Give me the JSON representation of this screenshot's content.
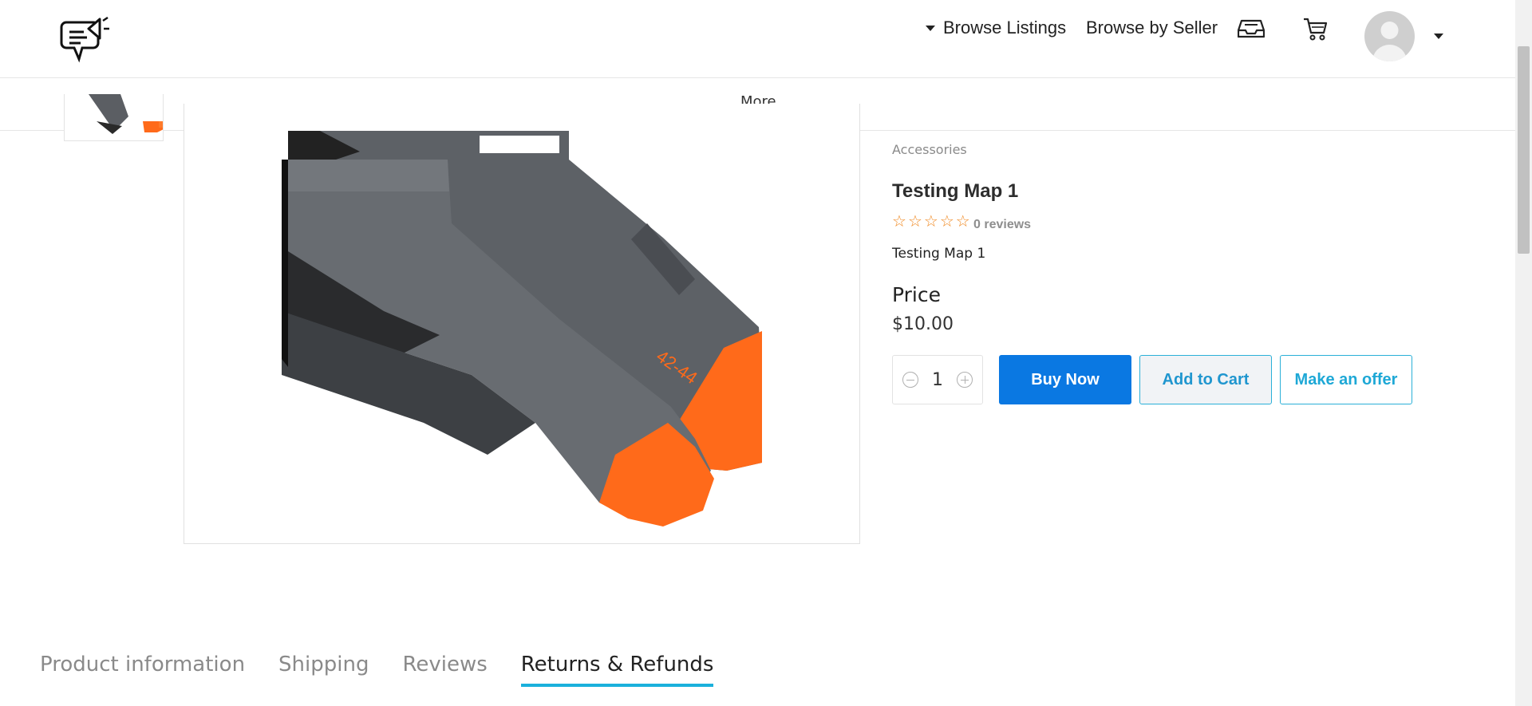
{
  "header": {
    "logo": "chat-megaphone-logo",
    "browse_listings": "Browse Listings",
    "browse_by_seller": "Browse by Seller",
    "icons": [
      "inbox-icon",
      "cart-icon",
      "avatar",
      "caret-down-icon"
    ]
  },
  "subnav": {
    "more": "More"
  },
  "product": {
    "category": "Accessories",
    "title": "Testing Map 1",
    "rating": 0,
    "rating_max": 5,
    "reviews": "0 reviews",
    "description": "Testing Map 1",
    "price_label": "Price",
    "price": "$10.00",
    "quantity": "1"
  },
  "actions": {
    "buy_now": "Buy Now",
    "add_to_cart": "Add to Cart",
    "make_offer": "Make an offer"
  },
  "tabs": [
    {
      "label": "Product information",
      "active": false
    },
    {
      "label": "Shipping",
      "active": false
    },
    {
      "label": "Reviews",
      "active": false
    },
    {
      "label": "Returns & Refunds",
      "active": true
    }
  ],
  "colors": {
    "primary": "#0a78e2",
    "accent": "#1ab0dc",
    "star": "#f08a24"
  }
}
